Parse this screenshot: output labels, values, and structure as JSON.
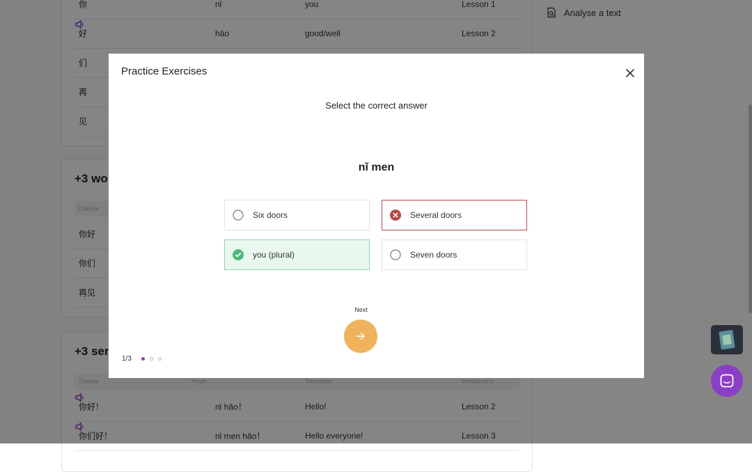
{
  "background": {
    "card1": {
      "rows": [
        {
          "chinese": "你",
          "pinyin": "nǐ",
          "translation": "you",
          "lesson": "Lesson 1"
        },
        {
          "chinese": "好",
          "pinyin": "hǎo",
          "translation": "good/well",
          "lesson": "Lesson 2"
        },
        {
          "chinese": "们",
          "pinyin": "",
          "translation": "",
          "lesson": ""
        },
        {
          "chinese": "再",
          "pinyin": "",
          "translation": "",
          "lesson": ""
        },
        {
          "chinese": "见",
          "pinyin": "",
          "translation": "",
          "lesson": ""
        }
      ]
    },
    "card2": {
      "title": "+3 wo",
      "header": {
        "chinese": "Chinese"
      },
      "rows": [
        {
          "chinese": "你好"
        },
        {
          "chinese": "你们"
        },
        {
          "chinese": "再见"
        }
      ]
    },
    "card3": {
      "title": "+3 sen",
      "header": {
        "chinese": "Chinese",
        "pinyin": "Pinyin",
        "translation": "Translation",
        "lesson": "Introduced in"
      },
      "rows": [
        {
          "chinese": "你好！",
          "pinyin": "nǐ hǎo！",
          "translation": "Hello!",
          "lesson": "Lesson 2"
        },
        {
          "chinese": "你们好！",
          "pinyin": "nǐ men hǎo！",
          "translation": "Hello everyone!",
          "lesson": "Lesson 3"
        }
      ]
    },
    "sidebar": {
      "analyse_label": "Analyse a text"
    }
  },
  "modal": {
    "title": "Practice Exercises",
    "prompt": "Select the correct answer",
    "word": "nǐ men",
    "options": [
      {
        "label": "Six doors",
        "state": "unselected"
      },
      {
        "label": "Several doors",
        "state": "wrong"
      },
      {
        "label": "you (plural)",
        "state": "correct"
      },
      {
        "label": "Seven doors",
        "state": "unselected"
      }
    ],
    "next_label": "Next",
    "progress_text": "1/3",
    "progress_current": 1,
    "progress_total": 3
  },
  "colors": {
    "accent": "#8b3fc6",
    "next": "#f0b25c",
    "wrong": "#b94a48",
    "correct": "#4cb87a",
    "correct_bg": "#e9f8ef"
  },
  "icons": [
    "speaker-icon",
    "document-search-icon",
    "close-icon",
    "wrong-icon",
    "correct-icon",
    "arrow-right-icon",
    "chat-icon"
  ]
}
